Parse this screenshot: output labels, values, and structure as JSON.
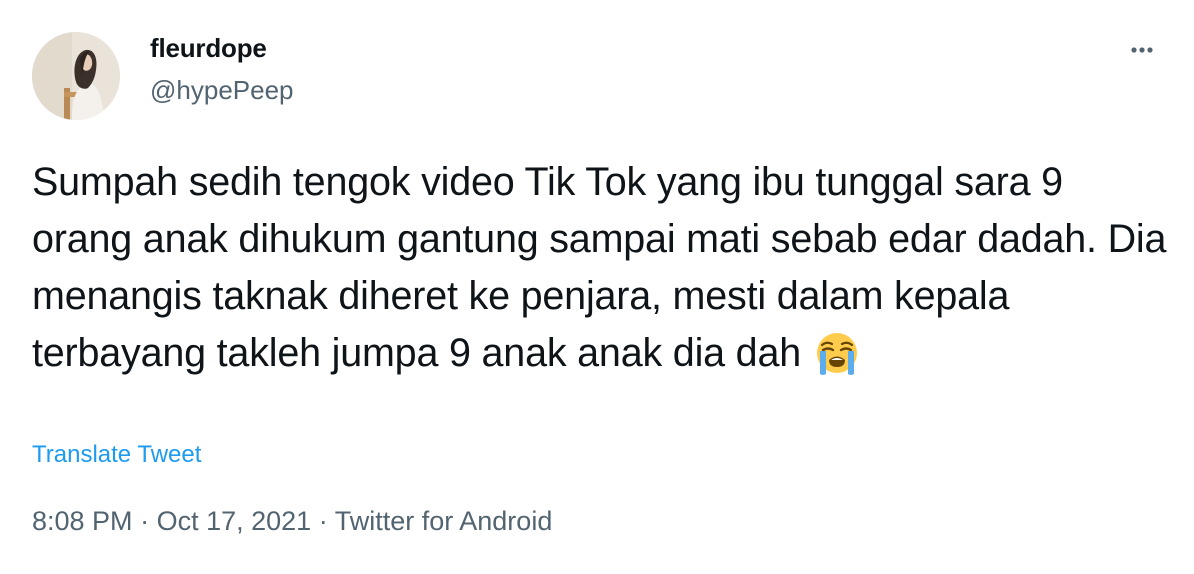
{
  "user": {
    "display_name": "fleurdope",
    "handle": "@hypePeep"
  },
  "tweet": {
    "text": "Sumpah sedih tengok video Tik Tok yang ibu tunggal sara 9 orang anak dihukum gantung sampai mati sebab edar dadah. Dia menangis taknak diheret ke penjara, mesti dalam kepala terbayang takleh jumpa 9 anak anak dia dah",
    "emoji": "loudly-crying-face-emoji",
    "translate_label": "Translate Tweet"
  },
  "meta": {
    "time": "8:08 PM",
    "date": "Oct 17, 2021",
    "source": "Twitter for Android",
    "separator": "·"
  },
  "icons": {
    "more": "more-options-icon"
  },
  "colors": {
    "text": "#0f1419",
    "secondary": "#536471",
    "link": "#1d9bf0"
  }
}
